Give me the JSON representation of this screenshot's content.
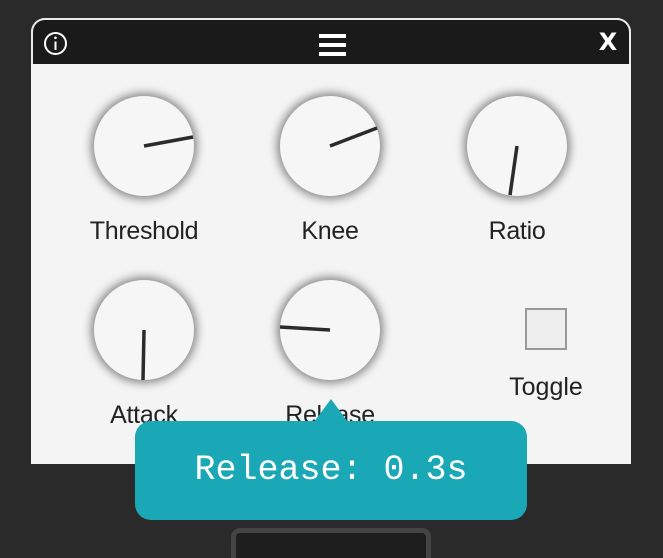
{
  "titlebar": {
    "info_icon": "info-icon",
    "menu_icon": "hamburger-menu-icon",
    "close_label": "X"
  },
  "knobs": [
    {
      "id": "threshold",
      "label": "Threshold"
    },
    {
      "id": "knee",
      "label": "Knee"
    },
    {
      "id": "ratio",
      "label": "Ratio"
    },
    {
      "id": "attack",
      "label": "Attack"
    },
    {
      "id": "release",
      "label": "Release"
    }
  ],
  "toggle": {
    "label": "Toggle",
    "checked": false
  },
  "tooltip": {
    "text": "Release: 0.3s"
  },
  "colors": {
    "titlebar": "#1a1a1a",
    "panel": "#f4f4f4",
    "tooltip": "#1aa8b6",
    "background": "#2a2a2a"
  }
}
